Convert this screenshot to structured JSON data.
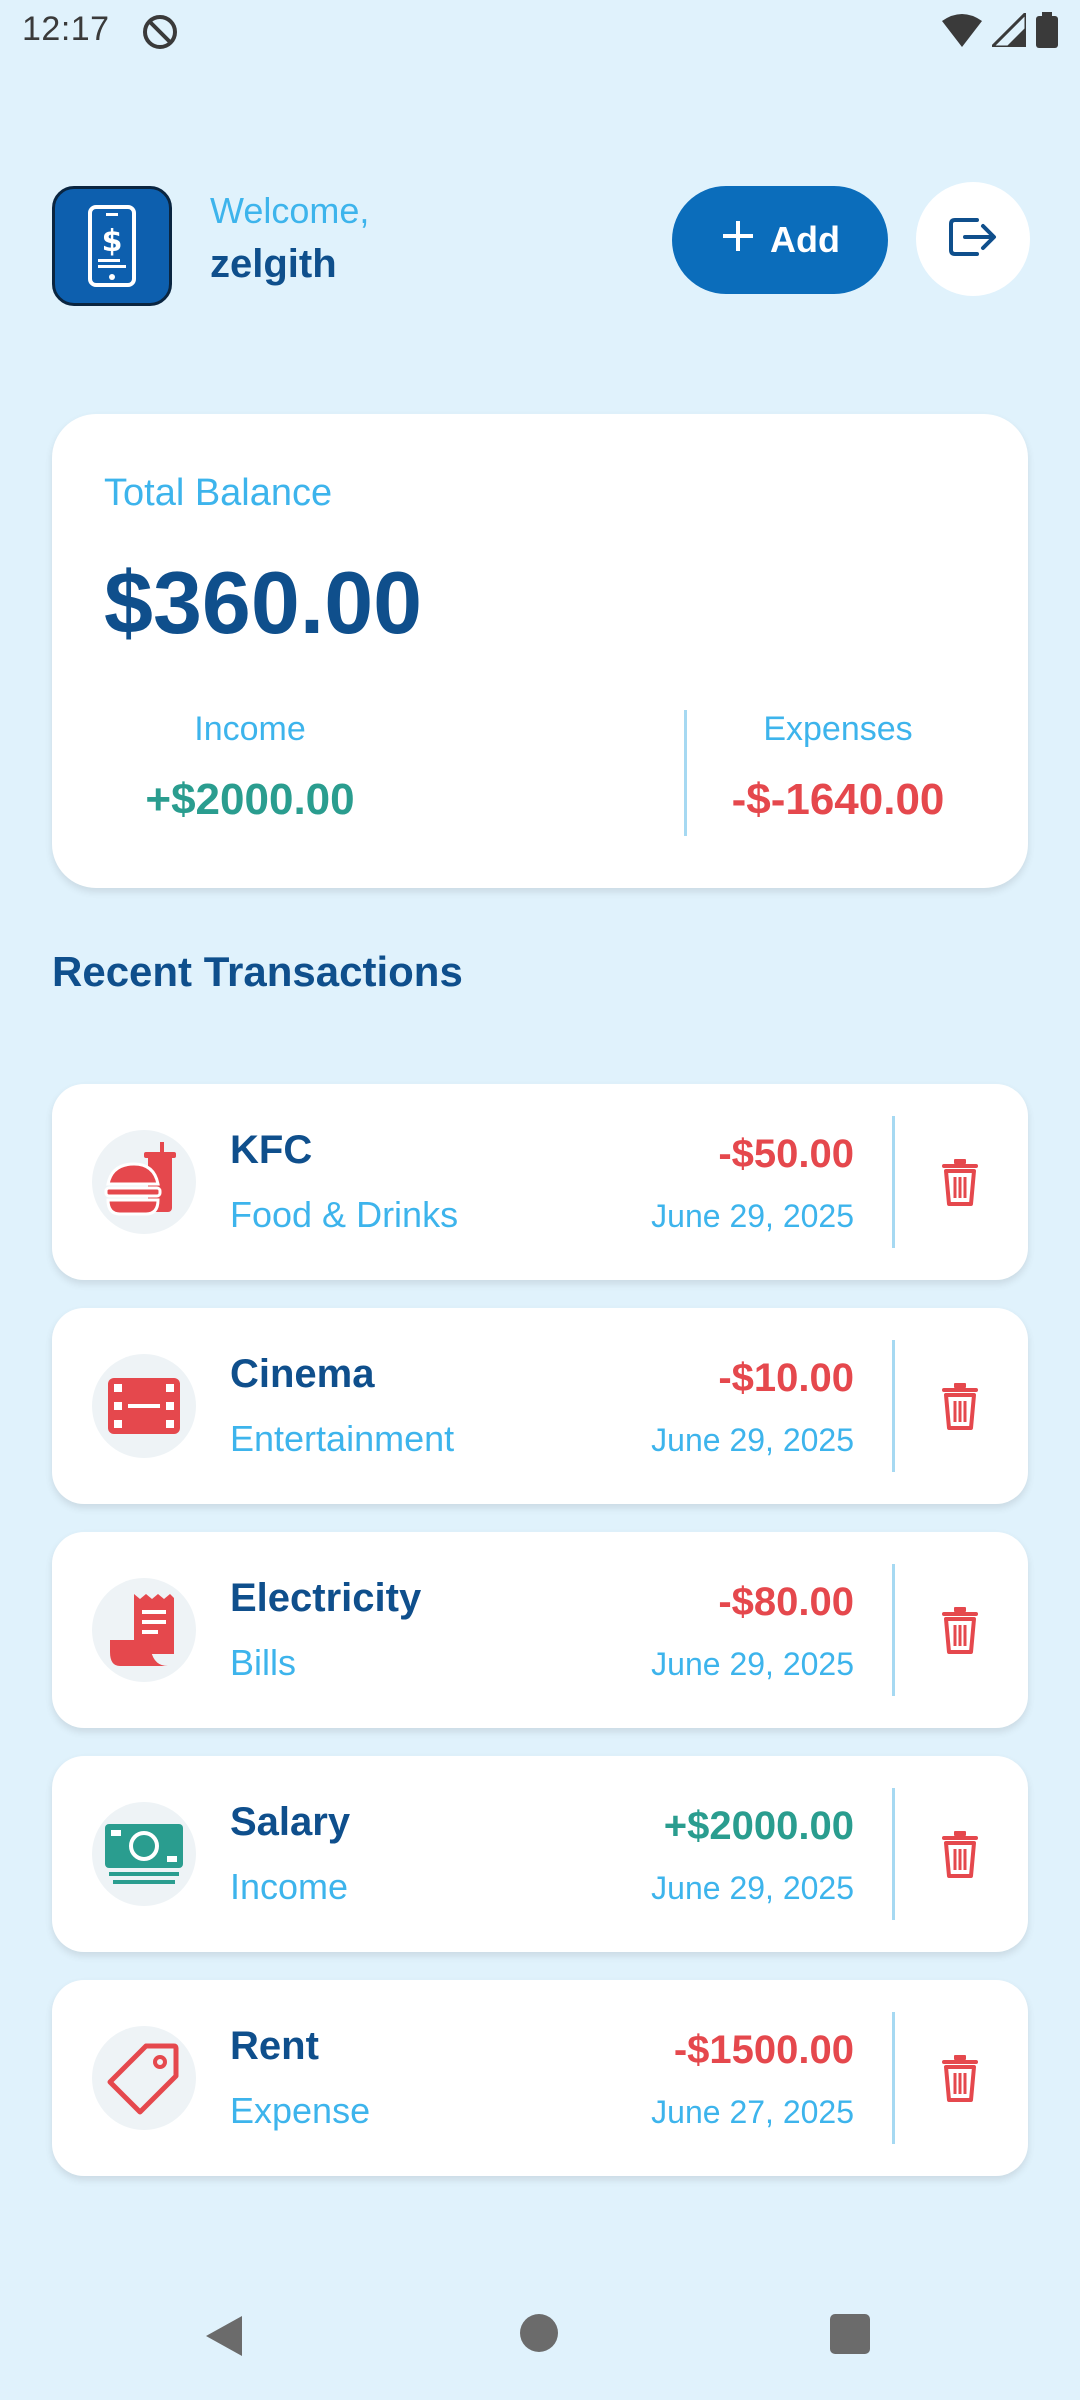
{
  "status_bar": {
    "time": "12:17",
    "icons": [
      "do-not-disturb-icon",
      "wifi-icon",
      "signal-icon",
      "battery-icon"
    ]
  },
  "header": {
    "greeting": "Welcome,",
    "username": "zelgith",
    "add_label": "Add",
    "logo_icon": "money-phone-icon",
    "logout_icon": "logout-icon"
  },
  "balance": {
    "label": "Total Balance",
    "amount": "$360.00",
    "income_label": "Income",
    "income_value": "+$2000.00",
    "expenses_label": "Expenses",
    "expenses_value": "-$-1640.00"
  },
  "recent": {
    "title": "Recent Transactions",
    "items": [
      {
        "title": "KFC",
        "category": "Food & Drinks",
        "amount": "-$50.00",
        "date": "June 29, 2025",
        "icon": "fastfood-icon",
        "type": "expense"
      },
      {
        "title": "Cinema",
        "category": "Entertainment",
        "amount": "-$10.00",
        "date": "June 29, 2025",
        "icon": "film-icon",
        "type": "expense"
      },
      {
        "title": "Electricity",
        "category": "Bills",
        "amount": "-$80.00",
        "date": "June 29, 2025",
        "icon": "receipt-icon",
        "type": "expense"
      },
      {
        "title": "Salary",
        "category": "Income",
        "amount": "+$2000.00",
        "date": "June 29, 2025",
        "icon": "money-icon",
        "type": "income"
      },
      {
        "title": "Rent",
        "category": "Expense",
        "amount": "-$1500.00",
        "date": "June 27, 2025",
        "icon": "tag-icon",
        "type": "expense"
      }
    ]
  },
  "colors": {
    "background": "#e0f2fc",
    "primary": "#0b6dbb",
    "heading": "#0f4f8c",
    "accent": "#3db4ec",
    "income": "#2a9d8f",
    "expense": "#e5484d"
  }
}
